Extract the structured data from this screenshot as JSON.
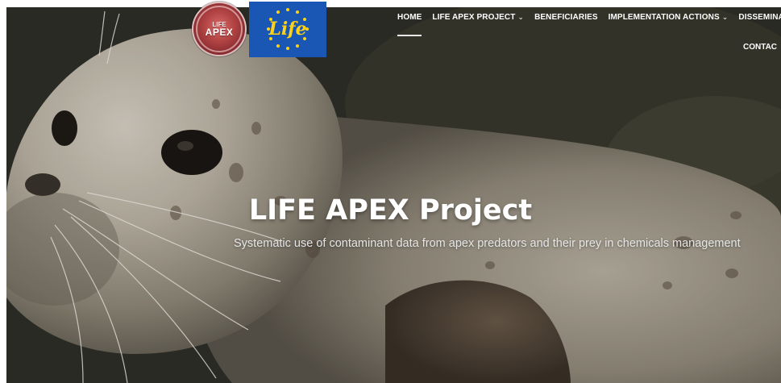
{
  "nav": {
    "items": [
      {
        "label": "HOME",
        "dropdown": false,
        "active": true
      },
      {
        "label": "LIFE APEX PROJECT",
        "dropdown": true,
        "active": false
      },
      {
        "label": "BENEFICIARIES",
        "dropdown": false,
        "active": false
      },
      {
        "label": "IMPLEMENTATION ACTIONS",
        "dropdown": true,
        "active": false
      },
      {
        "label": "DISSEMINATIO",
        "dropdown": false,
        "active": false
      }
    ],
    "second_row_label": "CONTAC"
  },
  "logos": {
    "apex_top": "LIFE",
    "apex_main": "APEX",
    "eu_life": "Life"
  },
  "hero": {
    "title": "LIFE APEX Project",
    "subtitle": "Systematic use of contaminant data from apex predators and their prey in chemicals management"
  },
  "colors": {
    "eu_blue": "#1a56b3",
    "eu_star": "#ffd21a",
    "nav_text": "#ffffff"
  }
}
